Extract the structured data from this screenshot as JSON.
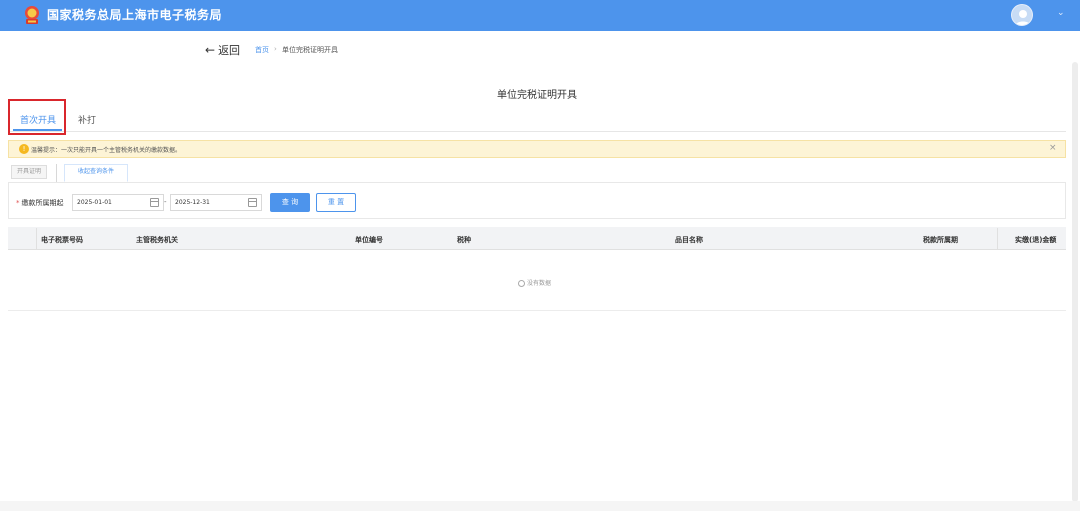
{
  "header": {
    "title": "国家税务总局上海市电子税务局",
    "logo_icon": "tax-emblem-icon",
    "user_icon": "user-avatar-icon",
    "menu_icon": "chevron-down-icon",
    "bg_color": "#4d94ec"
  },
  "nav": {
    "back_label": "返回",
    "breadcrumb": {
      "home": "首页",
      "separator": "›",
      "current": "单位完税证明开具"
    }
  },
  "page": {
    "title": "单位完税证明开具"
  },
  "tabs": [
    {
      "label": "首次开具",
      "active": true
    },
    {
      "label": "补打",
      "active": false
    }
  ],
  "notice": {
    "text": "温馨提示：一次只能开具一个主管税务机关的缴款数据。",
    "close": "×"
  },
  "subtoolbar": {
    "issue_label": "开具证明",
    "fold_label": "收起查询条件"
  },
  "filter": {
    "label": "缴款所属期起",
    "required_mark": "*",
    "start_date": "2025-01-01",
    "separator": "-",
    "end_date": "2025-12-31",
    "query_label": "查 询",
    "reset_label": "重 置"
  },
  "table": {
    "columns": [
      "电子税票号码",
      "主管税务机关",
      "单位编号",
      "税种",
      "品目名称",
      "税款所属期",
      "实缴(退)金额"
    ],
    "empty_text": "没有数据"
  },
  "colors": {
    "accent": "#4d94ec",
    "highlight": "#d9262c",
    "notice_bg": "#fdf4d6"
  }
}
